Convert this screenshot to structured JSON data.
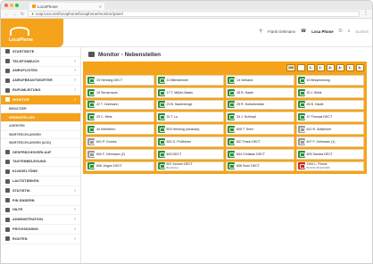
{
  "browser": {
    "tab_title": "LocaPhone",
    "url": "voip.loca.net/locaphone/locaphone/monitor/panel"
  },
  "header": {
    "logo_text": "LocaPhone",
    "user": "Frank Oehmann",
    "phone": "Loca Phone",
    "search_placeholder": "Suchen"
  },
  "sidebar": {
    "items": [
      {
        "label": "STARTSEITE",
        "icon": "home-icon",
        "active": false,
        "chevron": false
      },
      {
        "label": "TELEFONBUCH",
        "icon": "phonebook-icon",
        "active": false,
        "chevron": true
      },
      {
        "label": "ANRUFLISTEN",
        "icon": "call-list-icon",
        "active": false,
        "chevron": true
      },
      {
        "label": "ANRUFBEANTWORTER",
        "icon": "voicemail-icon",
        "active": false,
        "chevron": true
      },
      {
        "label": "RUFUMLEITUNG",
        "icon": "forward-icon",
        "active": false,
        "chevron": true
      },
      {
        "label": "MONITOR",
        "icon": "monitor-icon",
        "active": true,
        "chevron": true
      }
    ],
    "subitems": [
      {
        "label": "BENUTZER",
        "active": false
      },
      {
        "label": "NEBENSTELLEN",
        "active": true
      },
      {
        "label": "AGENTEN",
        "active": false
      },
      {
        "label": "WARTESCHLANGEN",
        "active": false
      },
      {
        "label": "WARTESCHLANGEN (ACD)",
        "active": false
      }
    ],
    "items2": [
      {
        "label": "GESPRÄCHSVERLAUF",
        "icon": "history-icon",
        "chevron": false
      },
      {
        "label": "TASTENBELEGUNG",
        "icon": "keys-icon",
        "chevron": false
      },
      {
        "label": "KLINGELTÖNE",
        "icon": "bell-icon",
        "chevron": false
      },
      {
        "label": "LAUTSTÄRKEN",
        "icon": "volume-icon",
        "chevron": false
      },
      {
        "label": "STATISTIK",
        "icon": "stats-icon",
        "chevron": true
      },
      {
        "label": "PIN ÄNDERN",
        "icon": "pin-icon",
        "chevron": false
      },
      {
        "label": "HILFE",
        "icon": "help-icon",
        "chevron": true
      },
      {
        "label": "ADMINISTRATION",
        "icon": "admin-icon",
        "chevron": true
      },
      {
        "label": "PROVISIONING",
        "icon": "provisioning-icon",
        "chevron": true
      },
      {
        "label": "ROUTEN",
        "icon": "routes-icon",
        "chevron": true
      }
    ]
  },
  "main": {
    "title": "Monitor - Nebenstellen",
    "toolbar_buttons": [
      "100",
      "",
      "1↓",
      "1↑",
      "A↓",
      "A↑",
      "1↓",
      "A↓"
    ]
  },
  "extensions": [
    {
      "name": "10 Henning DECT",
      "sub": "",
      "status": "green"
    },
    {
      "name": "11 Billerdimmer",
      "sub": "",
      "status": "green"
    },
    {
      "name": "14 Verband",
      "sub": "",
      "status": "green"
    },
    {
      "name": "15 Besprechung",
      "sub": "",
      "status": "green"
    },
    {
      "name": "15 Serverraum",
      "sub": "",
      "status": "green"
    },
    {
      "name": "17 T. Müller-Wastx",
      "sub": "",
      "status": "green"
    },
    {
      "name": "18 R. Haufe",
      "sub": "",
      "status": "green"
    },
    {
      "name": "20 J. Brink",
      "sub": "",
      "status": "green"
    },
    {
      "name": "22 T. Oohmann",
      "sub": "",
      "status": "green"
    },
    {
      "name": "23 B. Saubreenge",
      "sub": "",
      "status": "green"
    },
    {
      "name": "25 R. Hollschneider",
      "sub": "",
      "status": "green"
    },
    {
      "name": "26 B. Haufe",
      "sub": "",
      "status": "green"
    },
    {
      "name": "29 C. Weis",
      "sub": "",
      "status": "green"
    },
    {
      "name": "31 T. Lu",
      "sub": "",
      "status": "green"
    },
    {
      "name": "34 J. Schimpf",
      "sub": "",
      "status": "green"
    },
    {
      "name": "37 Thomas DECT",
      "sub": "",
      "status": "green"
    },
    {
      "name": "44 Kellerbüro",
      "sub": "",
      "status": "green"
    },
    {
      "name": "603 Henning (schauss)",
      "sub": "",
      "status": "green"
    },
    {
      "name": "605 T. Sven",
      "sub": "",
      "status": "green"
    },
    {
      "name": "612 B. Softphone",
      "sub": "",
      "status": "gray"
    },
    {
      "name": "601 P. Gomes",
      "sub": "",
      "status": "gray"
    },
    {
      "name": "602 G. Prüfhöner",
      "sub": "",
      "status": "green"
    },
    {
      "name": "607 Frank DECT",
      "sub": "",
      "status": "green"
    },
    {
      "name": "607 F. Oehmann (1)",
      "sub": "",
      "status": "gray"
    },
    {
      "name": "600 F. Oehmann (2)",
      "sub": "",
      "status": "gray"
    },
    {
      "name": "603 DECT",
      "sub": "",
      "status": "green"
    },
    {
      "name": "604 Christian DECT",
      "sub": "",
      "status": "green"
    },
    {
      "name": "605 Sandra DECT",
      "sub": "",
      "status": "green"
    },
    {
      "name": "606 Jürgen DECT",
      "sub": "",
      "status": "green"
    },
    {
      "name": "607 Jochen DECT",
      "sub": "BüroFluIne",
      "status": "green"
    },
    {
      "name": "608 Sven DECT",
      "sub": "",
      "status": "green"
    },
    {
      "name": "1100 L. Phone",
      "sub": "BUSOR 0911201009",
      "status": "red"
    }
  ]
}
